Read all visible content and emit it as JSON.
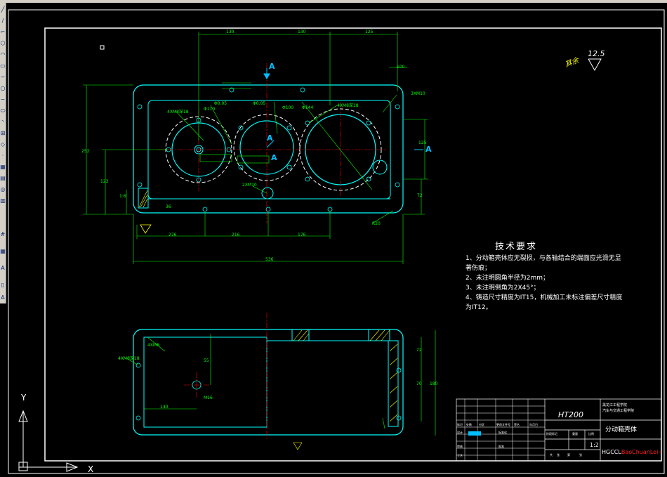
{
  "technical_requirements": {
    "title": "技术要求",
    "lines": [
      "1、分动箱壳体应无裂损，与各轴结合的端面应光滑无显",
      "著伤痕；",
      "2、未注明圆角半径为2mm；",
      "3、未注明倒角为2X45°；",
      "4、铸造尺寸精度为IT15，机械加工未标注偏差尺寸精度",
      "为IT12。"
    ]
  },
  "title_block": {
    "material": "HT200",
    "part_name": "分动箱壳体",
    "school_line1": "黑龙江工程学院",
    "school_line2": "汽车与交通工程学院",
    "scale": "1:2",
    "watermark_prefix": "HGCCL",
    "watermark_highlight": "BaoChuanLei~",
    "cell_labels": [
      "标记",
      "处数",
      "分区",
      "更改文件号",
      "签名",
      "年月日",
      "设计",
      "审核",
      "工艺",
      "标准化",
      "批准",
      "阶段标记",
      "重量",
      "比例",
      "共",
      "张",
      "第",
      "张"
    ]
  },
  "roughness": {
    "value": "12.5",
    "label": "其余"
  },
  "section_labels": [
    "A",
    "A",
    "A",
    "A"
  ],
  "dimensions": {
    "top": [
      "130",
      "130",
      "125",
      "100"
    ],
    "bottom": [
      "276",
      "216",
      "176",
      "536"
    ],
    "left": [
      "252",
      "123",
      "1:6",
      "36"
    ],
    "right": [
      "125",
      "72",
      "R20"
    ],
    "holes": [
      "4XM8深18",
      "Φ0.05",
      "Φ0.05",
      "Φ110",
      "Φ100",
      "Φ144",
      "2XM10",
      "4XM8深18",
      "3XM10"
    ],
    "lower_view": [
      "4XM8深18",
      "4XM8",
      "55",
      "140",
      "M16",
      "72",
      "70",
      "180"
    ]
  },
  "colors": {
    "outline": "#00ffff",
    "dimension": "#00ff00",
    "center": "#ff0000",
    "hatch": "#ffff00",
    "frame": "#ffffff",
    "text": "#ffffff"
  }
}
